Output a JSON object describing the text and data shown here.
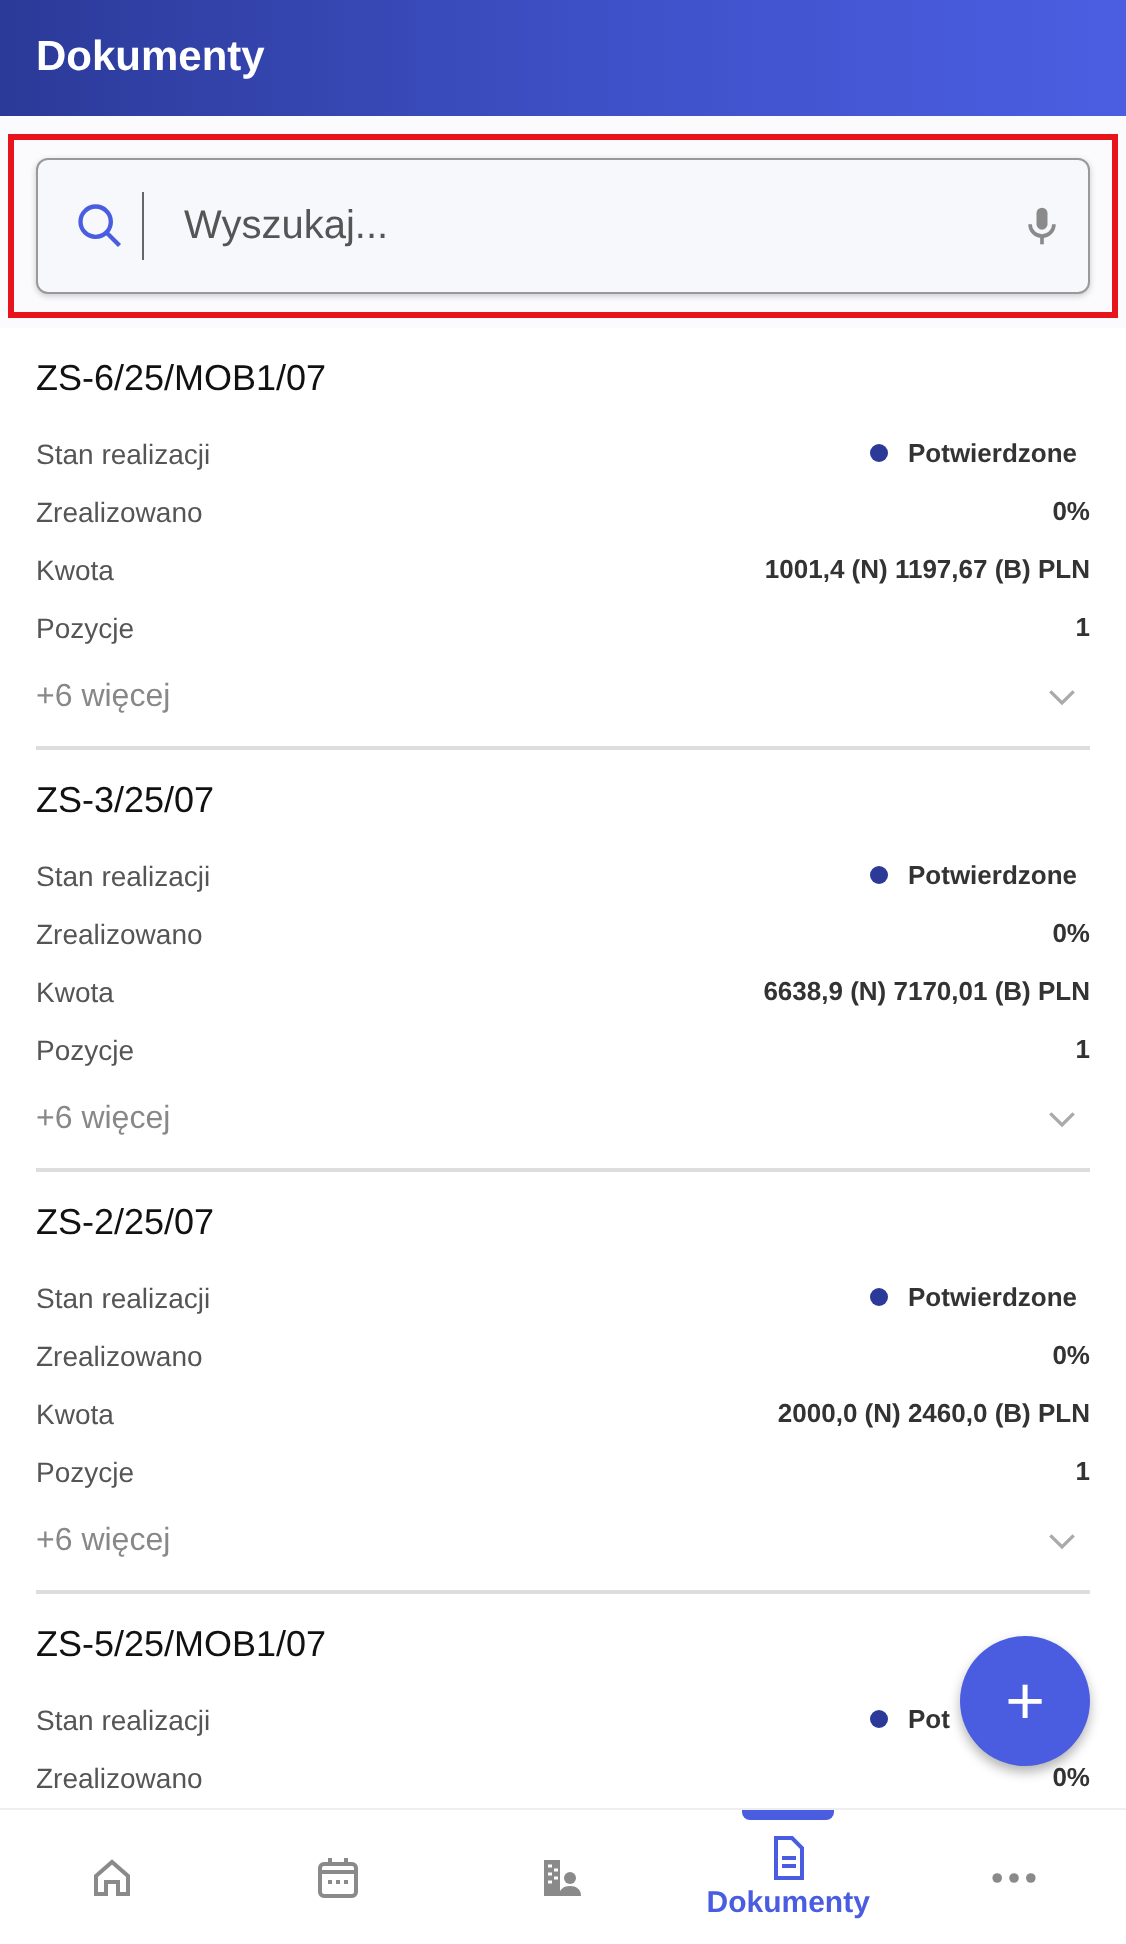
{
  "app_bar": {
    "title": "Dokumenty"
  },
  "search": {
    "placeholder": "Wyszukaj...",
    "highlighted": true
  },
  "documents": [
    {
      "number": "ZS-6/25/MOB1/07",
      "fields": [
        {
          "label": "Stan realizacji",
          "value": "Potwierdzone",
          "kind": "status"
        },
        {
          "label": "Zrealizowano",
          "value": "0%",
          "kind": "text"
        },
        {
          "label": "Kwota",
          "value": "1001,4 (N) 1197,67 (B) PLN",
          "kind": "text"
        },
        {
          "label": "Pozycje",
          "value": "1",
          "kind": "text"
        }
      ],
      "more": "+6 więcej"
    },
    {
      "number": "ZS-3/25/07",
      "fields": [
        {
          "label": "Stan realizacji",
          "value": "Potwierdzone",
          "kind": "status"
        },
        {
          "label": "Zrealizowano",
          "value": "0%",
          "kind": "text"
        },
        {
          "label": "Kwota",
          "value": "6638,9 (N) 7170,01 (B) PLN",
          "kind": "text"
        },
        {
          "label": "Pozycje",
          "value": "1",
          "kind": "text"
        }
      ],
      "more": "+6 więcej"
    },
    {
      "number": "ZS-2/25/07",
      "fields": [
        {
          "label": "Stan realizacji",
          "value": "Potwierdzone",
          "kind": "status"
        },
        {
          "label": "Zrealizowano",
          "value": "0%",
          "kind": "text"
        },
        {
          "label": "Kwota",
          "value": "2000,0 (N) 2460,0 (B) PLN",
          "kind": "text"
        },
        {
          "label": "Pozycje",
          "value": "1",
          "kind": "text"
        }
      ],
      "more": "+6 więcej"
    },
    {
      "number": "ZS-5/25/MOB1/07",
      "fields": [
        {
          "label": "Stan realizacji",
          "value": "Pot",
          "kind": "status"
        },
        {
          "label": "Zrealizowano",
          "value": "0%",
          "kind": "text"
        }
      ]
    }
  ],
  "fab": {
    "label": "+"
  },
  "bottom_nav": [
    {
      "kind": "home",
      "selected": false
    },
    {
      "kind": "calendar",
      "selected": false
    },
    {
      "kind": "contacts",
      "selected": false
    },
    {
      "kind": "document",
      "label": "Dokumenty",
      "selected": true
    },
    {
      "kind": "more",
      "selected": false
    }
  ]
}
